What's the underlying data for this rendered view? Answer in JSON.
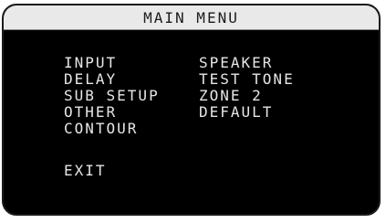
{
  "menu": {
    "title": "MAIN MENU",
    "left_items": [
      {
        "label": "INPUT"
      },
      {
        "label": "DELAY"
      },
      {
        "label": "SUB SETUP"
      },
      {
        "label": "OTHER"
      },
      {
        "label": "CONTOUR"
      }
    ],
    "right_items": [
      {
        "label": "SPEAKER"
      },
      {
        "label": "TEST TONE"
      },
      {
        "label": "ZONE 2"
      },
      {
        "label": "DEFAULT"
      }
    ],
    "exit_label": "EXIT"
  }
}
